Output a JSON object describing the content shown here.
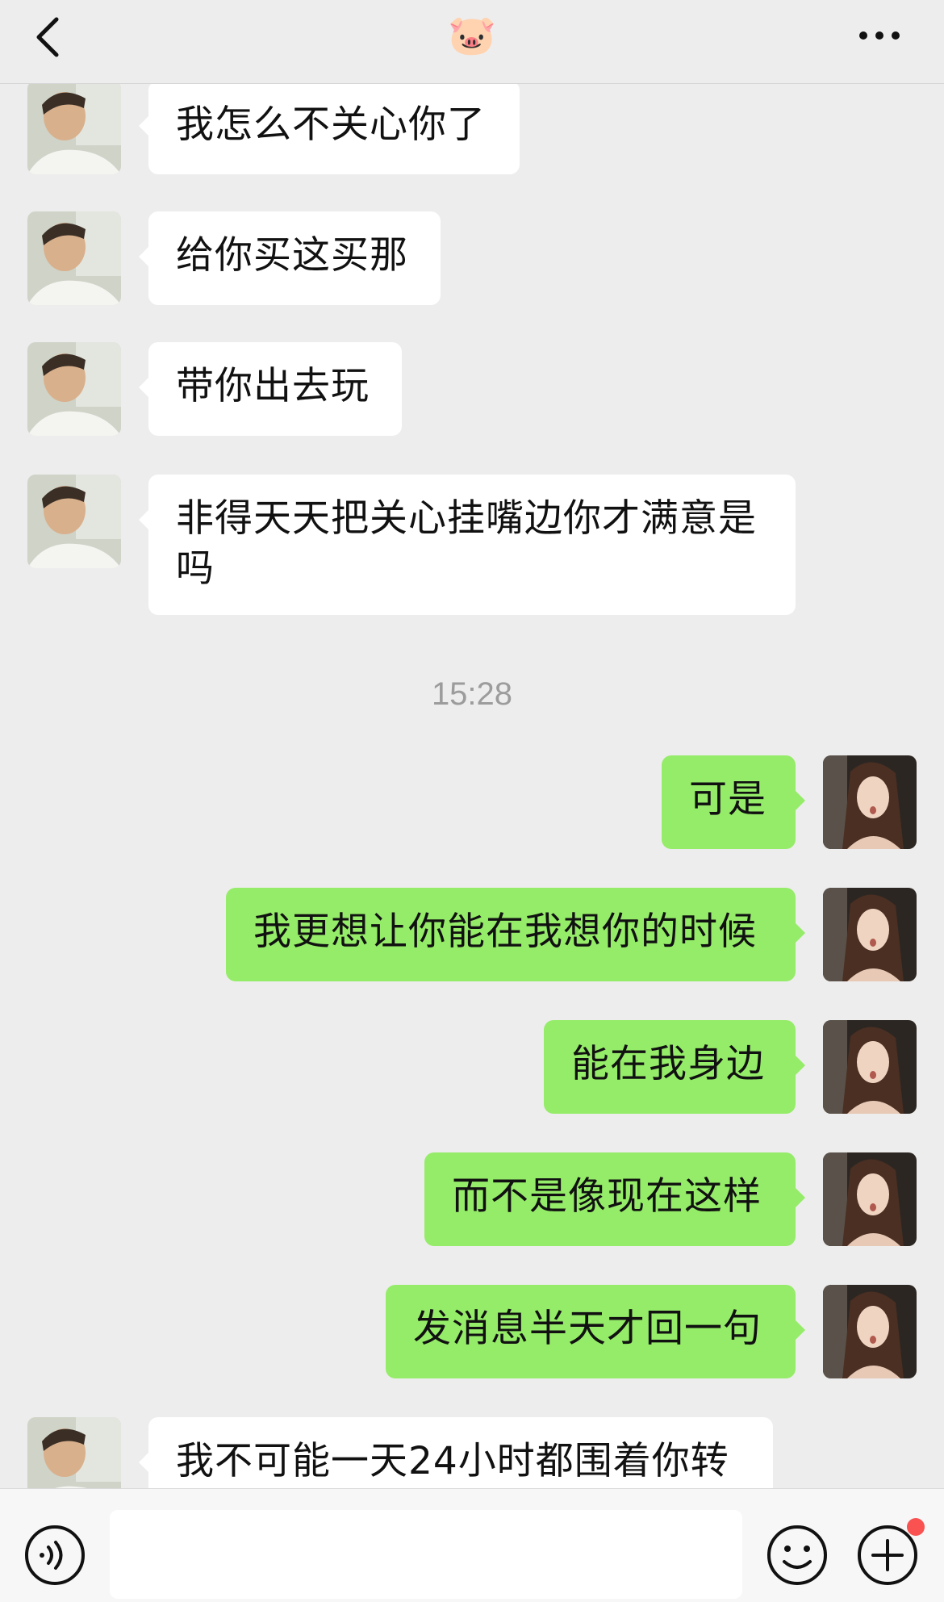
{
  "header": {
    "title_emoji": "🐷",
    "back_icon": "chevron-left-icon",
    "more_icon": "more-dots-icon"
  },
  "messages": [
    {
      "side": "left",
      "text": "我怎么不关心你了"
    },
    {
      "side": "left",
      "text": "给你买这买那"
    },
    {
      "side": "left",
      "text": "带你出去玩"
    },
    {
      "side": "left",
      "text": "非得天天把关心挂嘴边你才满意是吗"
    },
    {
      "side": "right",
      "text": "可是"
    },
    {
      "side": "right",
      "text": "我更想让你能在我想你的时候"
    },
    {
      "side": "right",
      "text": "能在我身边"
    },
    {
      "side": "right",
      "text": "而不是像现在这样"
    },
    {
      "side": "right",
      "text": "发消息半天才回一句"
    },
    {
      "side": "left",
      "text": "我不可能一天24小时都围着你转"
    }
  ],
  "timestamp": "15:28",
  "bottom_bar": {
    "voice_icon": "voice-icon",
    "emoji_icon": "emoji-face-icon",
    "plus_icon": "plus-icon"
  },
  "colors": {
    "background": "#ededed",
    "bubble_left": "#ffffff",
    "bubble_right": "#95ec69",
    "timestamp": "#9c9c9c",
    "notify_dot": "#fa5151"
  }
}
